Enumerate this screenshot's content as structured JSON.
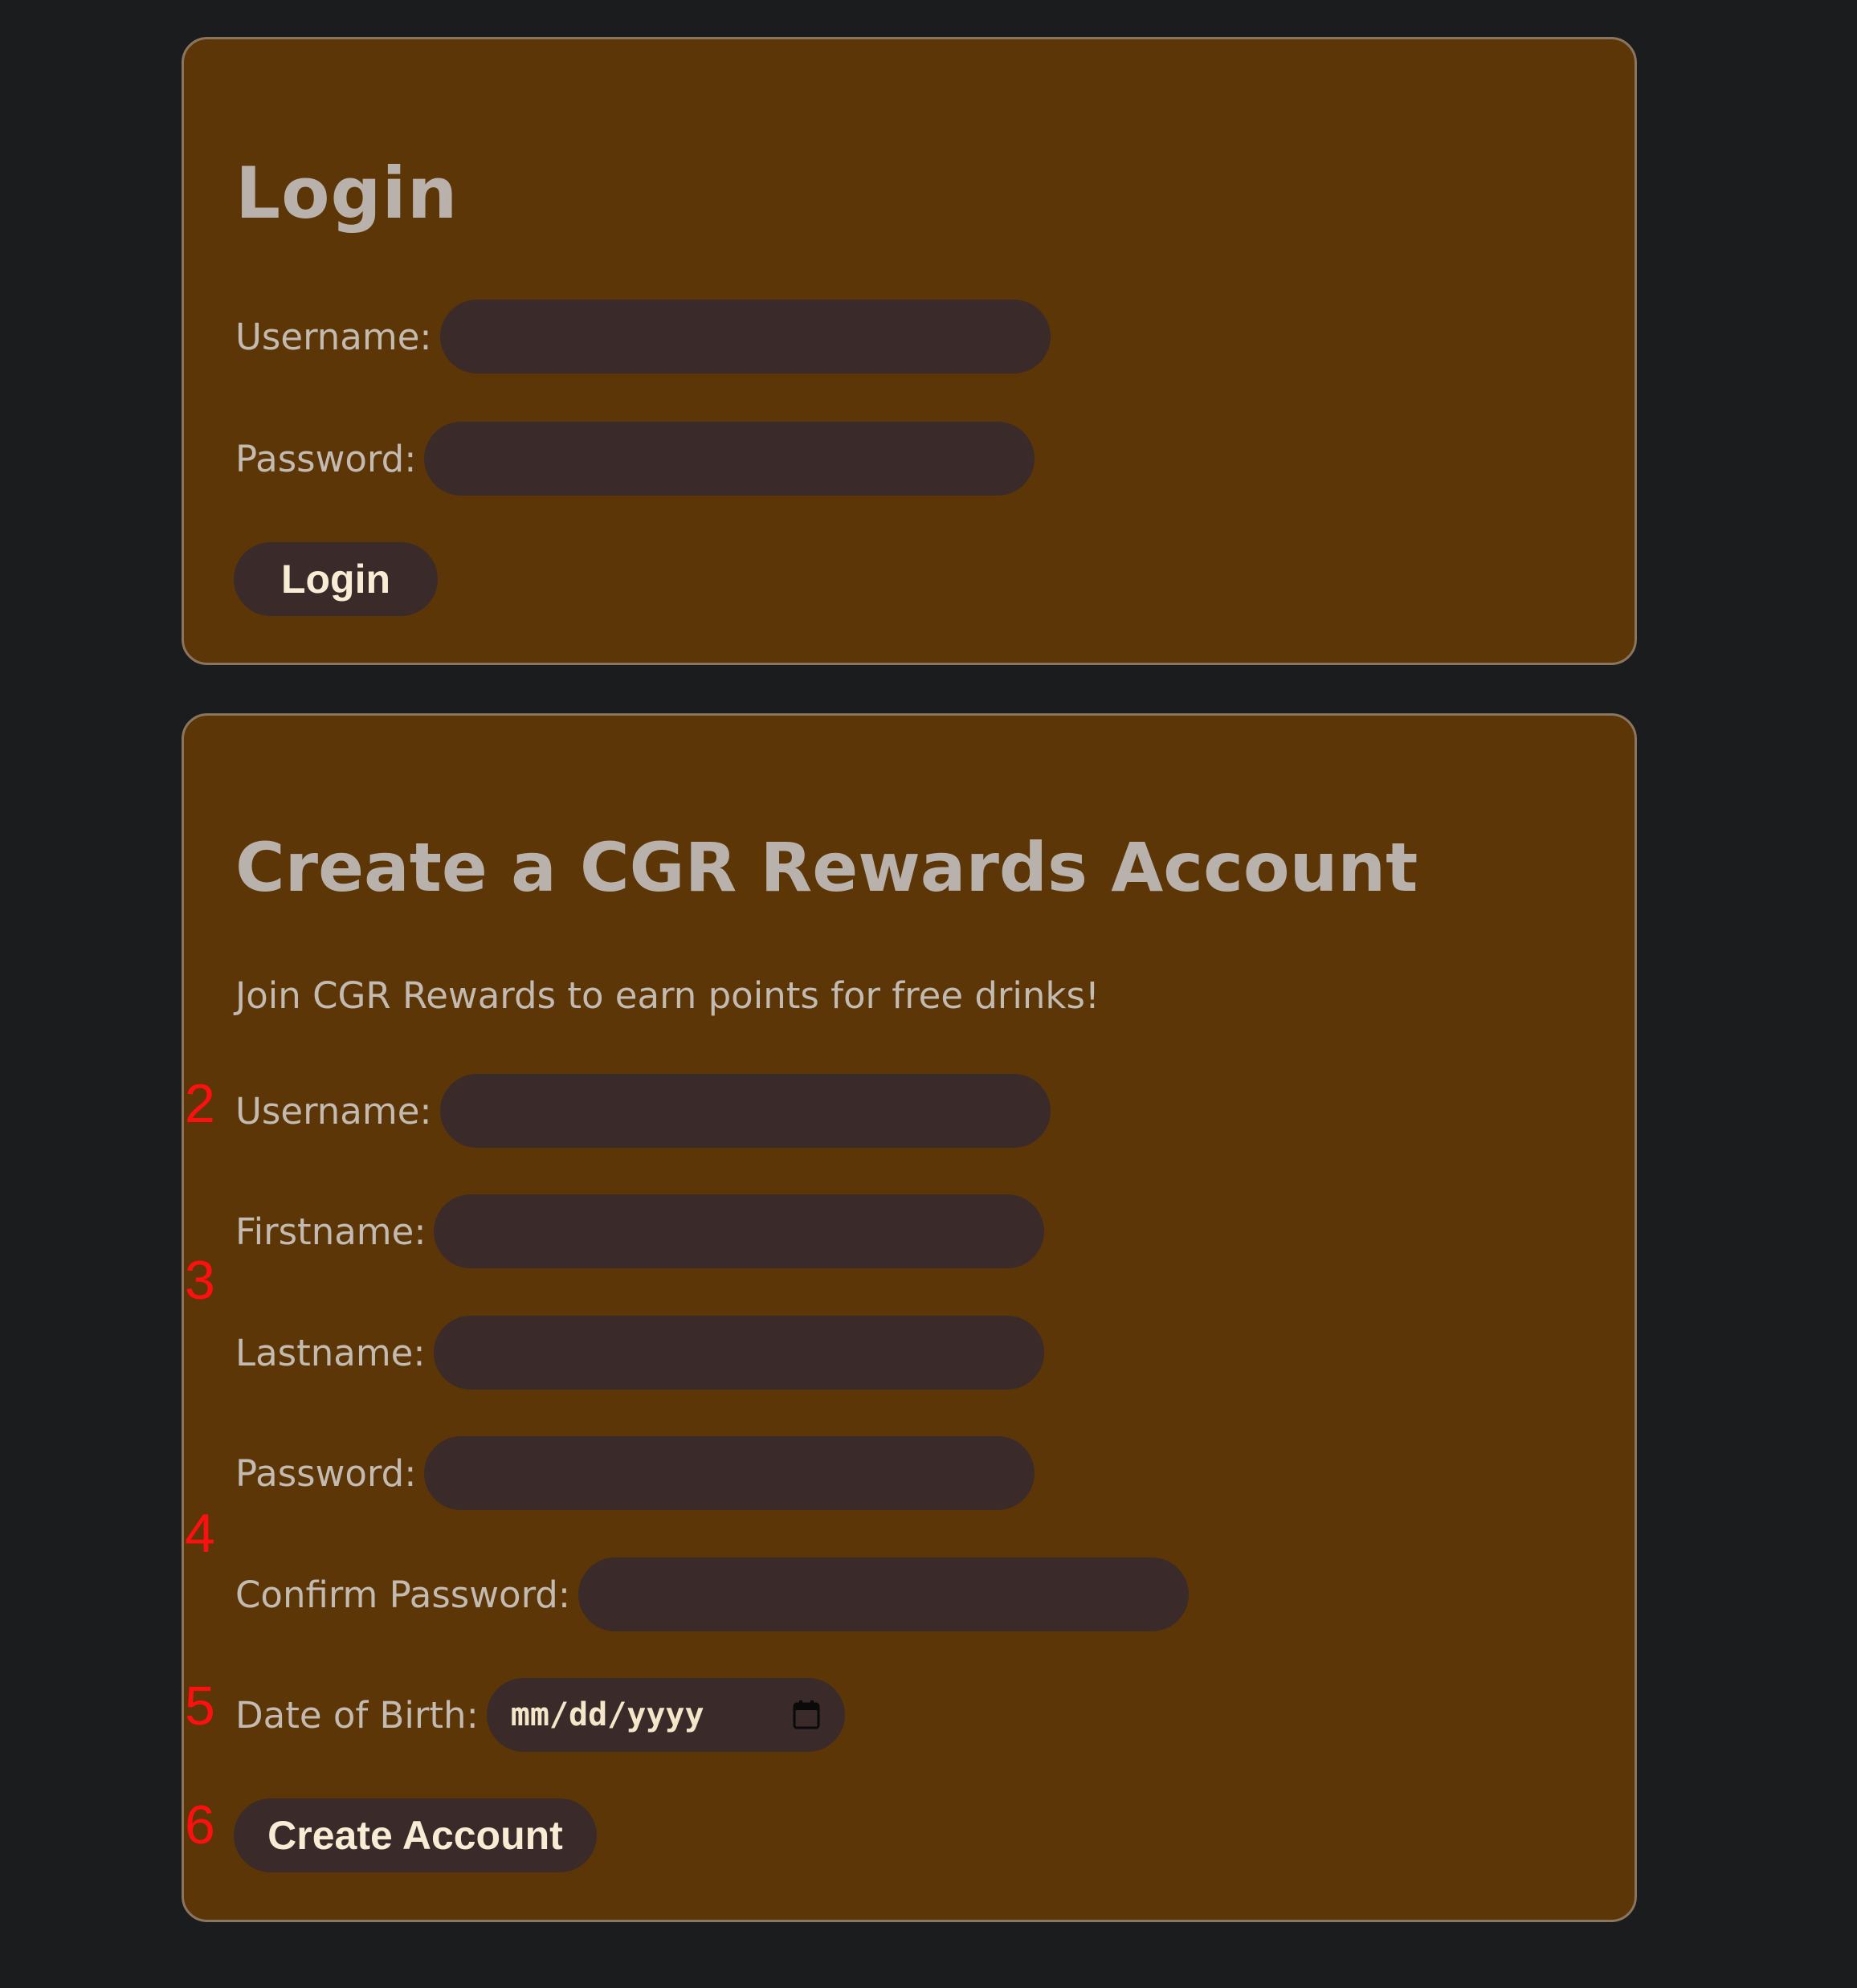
{
  "login": {
    "title": "Login",
    "username_label": "Username:",
    "password_label": "Password:",
    "username_value": "",
    "password_value": "",
    "button_label": "Login"
  },
  "register": {
    "title": "Create a CGR Rewards Account",
    "subtitle": "Join CGR Rewards to earn points for free drinks!",
    "username_label": "Username:",
    "firstname_label": "Firstname:",
    "lastname_label": "Lastname:",
    "password_label": "Password:",
    "confirm_password_label": "Confirm Password:",
    "dob_label": "Date of Birth:",
    "dob_placeholder": "mm/dd/yyyy",
    "button_label": "Create Account"
  },
  "markers": [
    "2",
    "3",
    "4",
    "5",
    "6"
  ],
  "colors": {
    "page_background": "#1b1c1e",
    "panel_background": "#5c3606",
    "panel_border": "#8a7560",
    "field_background": "#3a2b2a",
    "heading_text": "#b9b1ab",
    "button_text": "#f7ecd4",
    "marker": "#ff1010"
  }
}
